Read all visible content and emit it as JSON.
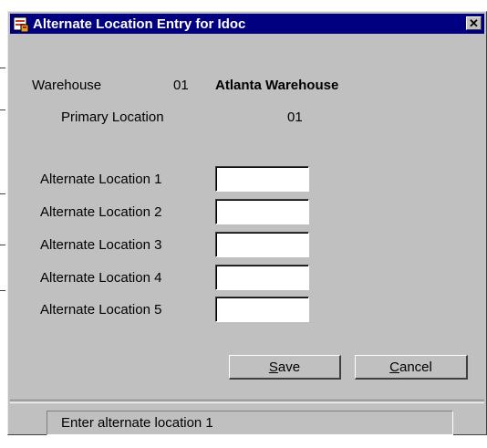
{
  "window": {
    "title": "Alternate Location Entry for Idoc",
    "close_glyph": "✕",
    "icon": "app-form-icon",
    "title_bar_color": "#000080"
  },
  "header": {
    "warehouse_label": "Warehouse",
    "warehouse_code": "01",
    "warehouse_name": "Atlanta Warehouse",
    "primary_location_label": "Primary Location",
    "primary_location_value": "01"
  },
  "fields": [
    {
      "label": "Alternate Location 1",
      "value": ""
    },
    {
      "label": "Alternate Location 2",
      "value": ""
    },
    {
      "label": "Alternate Location 3",
      "value": ""
    },
    {
      "label": "Alternate Location 4",
      "value": ""
    },
    {
      "label": "Alternate Location 5",
      "value": ""
    }
  ],
  "buttons": {
    "save_mnemonic": "S",
    "save_rest": "ave",
    "cancel_mnemonic": "C",
    "cancel_rest": "ancel"
  },
  "status": {
    "message": "Enter alternate location 1"
  }
}
